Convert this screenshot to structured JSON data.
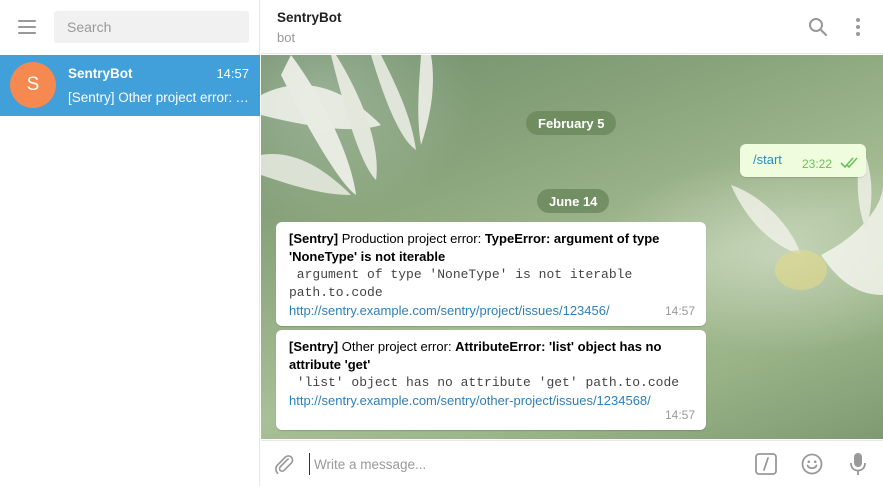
{
  "sidebar": {
    "search_placeholder": "Search",
    "chats": [
      {
        "name": "SentryBot",
        "time": "14:57",
        "preview": "[Sentry] Other project error: AttributeError: 'list' object has no attribute 'get'",
        "avatar_letter": "S",
        "avatar_color": "#f5894f"
      }
    ]
  },
  "header": {
    "title": "SentryBot",
    "status": "bot"
  },
  "messages": {
    "date1": "February 5",
    "outgoing": {
      "text": "/start",
      "time": "23:22"
    },
    "date2": "June 14",
    "incoming": [
      {
        "tag": "[Sentry]",
        "prefix": " Production project error: ",
        "error": "TypeError: argument of type 'NoneType' is not iterable",
        "code1": " argument of type 'NoneType' is not iterable",
        "code2": "path.to.code",
        "link": "http://sentry.example.com/sentry/project/issues/123456/",
        "time": "14:57"
      },
      {
        "tag": "[Sentry]",
        "prefix": " Other project error: ",
        "error": "AttributeError: 'list' object has no attribute 'get'",
        "code1": " 'list' object has no attribute 'get' path.to.code",
        "link": "http://sentry.example.com/sentry/other-project/issues/1234568/",
        "time": "14:57"
      }
    ]
  },
  "composer": {
    "placeholder": "Write a message..."
  },
  "colors": {
    "accent": "#419fd9",
    "avatar": "#f5894f",
    "outgoing_bubble": "#effdde",
    "link": "#2e7fb9"
  },
  "icons": [
    "menu-icon",
    "search-icon",
    "more-vertical-icon",
    "attach-icon",
    "commands-icon",
    "emoji-icon",
    "microphone-icon",
    "double-check-icon"
  ]
}
